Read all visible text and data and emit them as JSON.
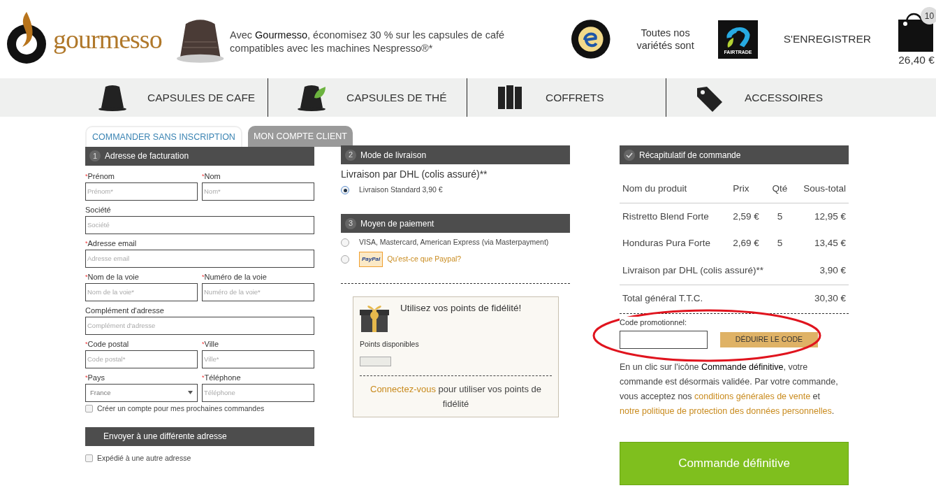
{
  "header": {
    "logo_text": "gourmesso",
    "promo": "Avec **Gourmesso**, économisez 30 % sur les capsules de café compatibles avec les machines Nespresso®*",
    "varieties_text": "Toutes nos variétés sont",
    "fairtrade_label": "FAIRTRADE",
    "register_link": "S'ENREGISTRER",
    "cart": {
      "count": "10",
      "total": "26,40 €"
    }
  },
  "nav": [
    {
      "label": "CAPSULES DE CAFE",
      "kind": "capsule"
    },
    {
      "label": "CAPSULES DE THÉ",
      "kind": "tea"
    },
    {
      "label": "COFFRETS",
      "kind": "boxes"
    },
    {
      "label": "ACCESSOIRES",
      "kind": "tag"
    }
  ],
  "tabs": [
    {
      "label": "COMMANDER SANS INSCRIPTION",
      "selected": true
    },
    {
      "label": "MON COMPTE CLIENT",
      "selected": false
    }
  ],
  "billing": {
    "number": "1",
    "title": "Adresse de facturation",
    "rows": [
      [
        {
          "mark": "*",
          "label": "Prénom",
          "placeholder": "Prénom*"
        },
        {
          "mark": "*",
          "label": "Nom",
          "placeholder": "Nom*"
        }
      ],
      [
        {
          "label": "Société",
          "placeholder": "Société"
        }
      ],
      [
        {
          "mark": "*",
          "label": "Adresse email",
          "placeholder": "Adresse email"
        }
      ],
      [
        {
          "mark": "*",
          "label": "Nom de la voie",
          "placeholder": "Nom de la voie*"
        },
        {
          "mark": "*",
          "label": "Numéro de la voie",
          "placeholder": "Numéro de la voie*"
        }
      ],
      [
        {
          "label": "Complément d'adresse",
          "placeholder": "Complément d'adresse"
        }
      ],
      [
        {
          "mark": "*",
          "label": "Code postal",
          "placeholder": "Code postal*"
        },
        {
          "mark": "*",
          "label": "Ville",
          "placeholder": "Ville*"
        }
      ],
      [
        {
          "mark": "*",
          "label": "Pays",
          "kind": "select",
          "value": "France"
        },
        {
          "mark": "*",
          "label": "Téléphone",
          "placeholder": "Téléphone"
        }
      ]
    ],
    "create_account": {
      "label": "Créer un compte pour mes prochaines commandes",
      "checked": false
    }
  },
  "shipping_address": {
    "title": "Envoyer à une différente adresse",
    "option": {
      "label": "Expédié à une autre adresse",
      "checked": false
    }
  },
  "delivery": {
    "number": "2",
    "title": "Mode de livraison",
    "carrier": "Livraison par DHL (colis assuré)**",
    "options": [
      {
        "label": "Livraison Standard 3,90 €",
        "selected": true
      }
    ]
  },
  "payment": {
    "number": "3",
    "title": "Moyen de paiement",
    "options": [
      {
        "kind": "text",
        "label": "VISA, Mastercard, American Express (via Masterpayment)",
        "selected": false
      },
      {
        "kind": "paypal",
        "logo": "PayPal",
        "label": "Qu'est-ce que Paypal?",
        "selected": false
      }
    ]
  },
  "loyalty": {
    "title": "Utilisez vos points de fidélité!",
    "points_label": "Points disponibles",
    "login_link": "Connectez-vous",
    "login_text": "pour utiliser vos points de fidélité"
  },
  "summary": {
    "title": "Récapitulatif de commande",
    "columns": [
      "Nom du produit",
      "Prix",
      "Qté",
      "Sous-total"
    ],
    "items": [
      {
        "name": "Ristretto Blend Forte",
        "price": "2,59 €",
        "qty": "5",
        "subtotal": "12,95 €"
      },
      {
        "name": "Honduras Pura Forte",
        "price": "2,69 €",
        "qty": "5",
        "subtotal": "13,45 €"
      }
    ],
    "shipping": {
      "label": "Livraison par DHL (colis assuré)**",
      "amount": "3,90 €"
    },
    "total": {
      "label": "Total général T.T.C.",
      "amount": "30,30 €"
    },
    "promo_label": "Code promotionnel:",
    "promo_button": "DÉDUIRE LE CODE",
    "legal": [
      {
        "kind": "plain",
        "text": "En un clic sur l'icône "
      },
      {
        "kind": "bold",
        "text": "Commande définitive"
      },
      {
        "kind": "plain",
        "text": ", votre commande est désormais validée. Par votre commande, vous acceptez nos "
      },
      {
        "kind": "link",
        "text": "conditions générales de vente"
      },
      {
        "kind": "plain",
        "text": " et "
      },
      {
        "kind": "link",
        "text": "notre politique de protection des données personnelles"
      },
      {
        "kind": "plain",
        "text": "."
      }
    ],
    "submit": "Commande définitive"
  }
}
